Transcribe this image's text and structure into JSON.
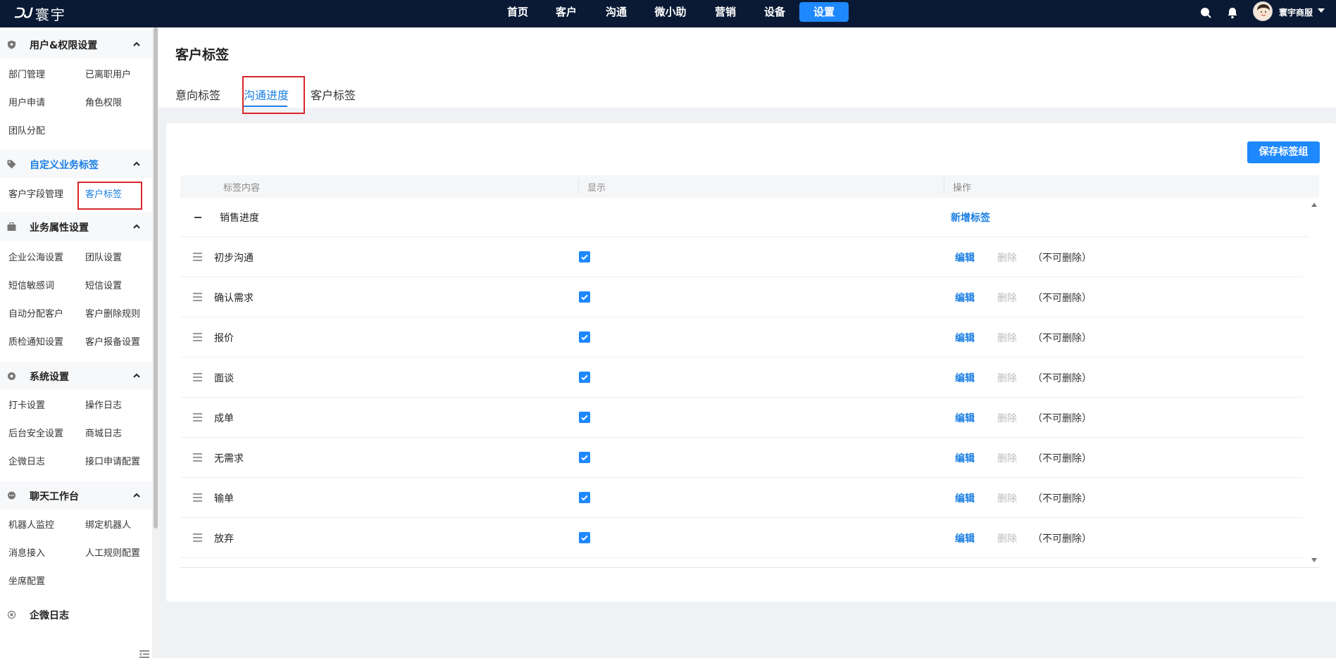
{
  "topbar": {
    "logo_mark": "ᑐᒍ",
    "logo_text": "寰宇",
    "nav": [
      "首页",
      "客户",
      "沟通",
      "微小助",
      "营销",
      "设备",
      "设置"
    ],
    "active_nav": "设置",
    "username": "寰宇商服",
    "icons": [
      "search-icon",
      "bell-icon",
      "avatar",
      "chevron-down-icon"
    ]
  },
  "sidebar": {
    "groups": [
      {
        "title": "用户&权限设置",
        "icon": "shield-icon",
        "items": [
          "部门管理",
          "已离职用户",
          "用户申请",
          "角色权限",
          "团队分配"
        ]
      },
      {
        "title": "自定义业务标签",
        "icon": "tag-icon",
        "items": [
          "客户字段管理",
          "客户标签"
        ],
        "active_item": "客户标签",
        "highlight": true
      },
      {
        "title": "业务属性设置",
        "icon": "briefcase-icon",
        "items": [
          "企业公海设置",
          "团队设置",
          "短信敏感词",
          "短信设置",
          "自动分配客户",
          "客户删除规则",
          "质检通知设置",
          "客户报备设置"
        ]
      },
      {
        "title": "系统设置",
        "icon": "gear-icon",
        "items": [
          "打卡设置",
          "操作日志",
          "后台安全设置",
          "商城日志",
          "企微日志",
          "接口申请配置"
        ]
      },
      {
        "title": "聊天工作台",
        "icon": "chat-icon",
        "items": [
          "机器人监控",
          "绑定机器人",
          "消息接入",
          "人工规则配置",
          "坐席配置"
        ]
      },
      {
        "title": "企微日志",
        "icon": "circle-icon",
        "items": []
      }
    ]
  },
  "main": {
    "title": "客户标签",
    "tabs": [
      "意向标签",
      "沟通进度",
      "客户标签"
    ],
    "active_tab": "沟通进度",
    "save_button": "保存标签组",
    "table": {
      "columns": [
        "标签内容",
        "显示",
        "操作"
      ],
      "group_name": "销售进度",
      "add_tag": "新增标签",
      "rows": [
        {
          "name": "初步沟通",
          "shown": true
        },
        {
          "name": "确认需求",
          "shown": true
        },
        {
          "name": "报价",
          "shown": true
        },
        {
          "name": "面谈",
          "shown": true
        },
        {
          "name": "成单",
          "shown": true
        },
        {
          "name": "无需求",
          "shown": true
        },
        {
          "name": "输单",
          "shown": true
        },
        {
          "name": "放弃",
          "shown": true
        }
      ],
      "edit_label": "编辑",
      "delete_label": "删除",
      "undeletable_label": "（不可删除）"
    }
  },
  "colors": {
    "accent": "#1e88ff",
    "topbar": "#0a1a35",
    "highlight_box": "#d9262a"
  }
}
